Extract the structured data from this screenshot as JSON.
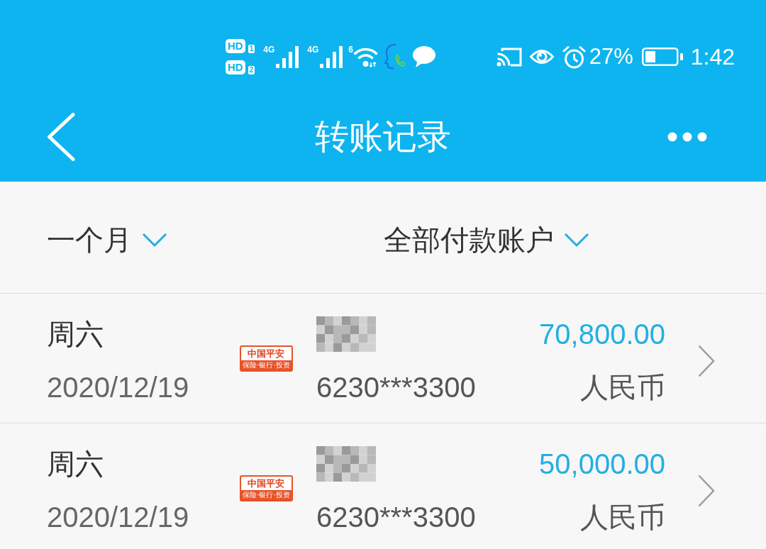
{
  "status_bar": {
    "sim_indicators": [
      {
        "label": "HD",
        "slot": "1"
      },
      {
        "label": "HD",
        "slot": "2"
      }
    ],
    "networks": [
      {
        "type": "4G"
      },
      {
        "type": "4G"
      }
    ],
    "wifi_standard": "6",
    "battery_percent": "27%",
    "time": "1:42"
  },
  "title_bar": {
    "title": "转账记录"
  },
  "filters": [
    {
      "label": "一个月"
    },
    {
      "label": "全部付款账户"
    }
  ],
  "transfers": [
    {
      "weekday": "周六",
      "date": "2020/12/19",
      "bank_logo": {
        "name": "中国平安",
        "slogan": "保险·银行·投资"
      },
      "account": "6230***3300",
      "amount": "70,800.00",
      "currency": "人民币"
    },
    {
      "weekday": "周六",
      "date": "2020/12/19",
      "bank_logo": {
        "name": "中国平安",
        "slogan": "保险·银行·投资"
      },
      "account": "6230***3300",
      "amount": "50,000.00",
      "currency": "人民币"
    }
  ]
}
